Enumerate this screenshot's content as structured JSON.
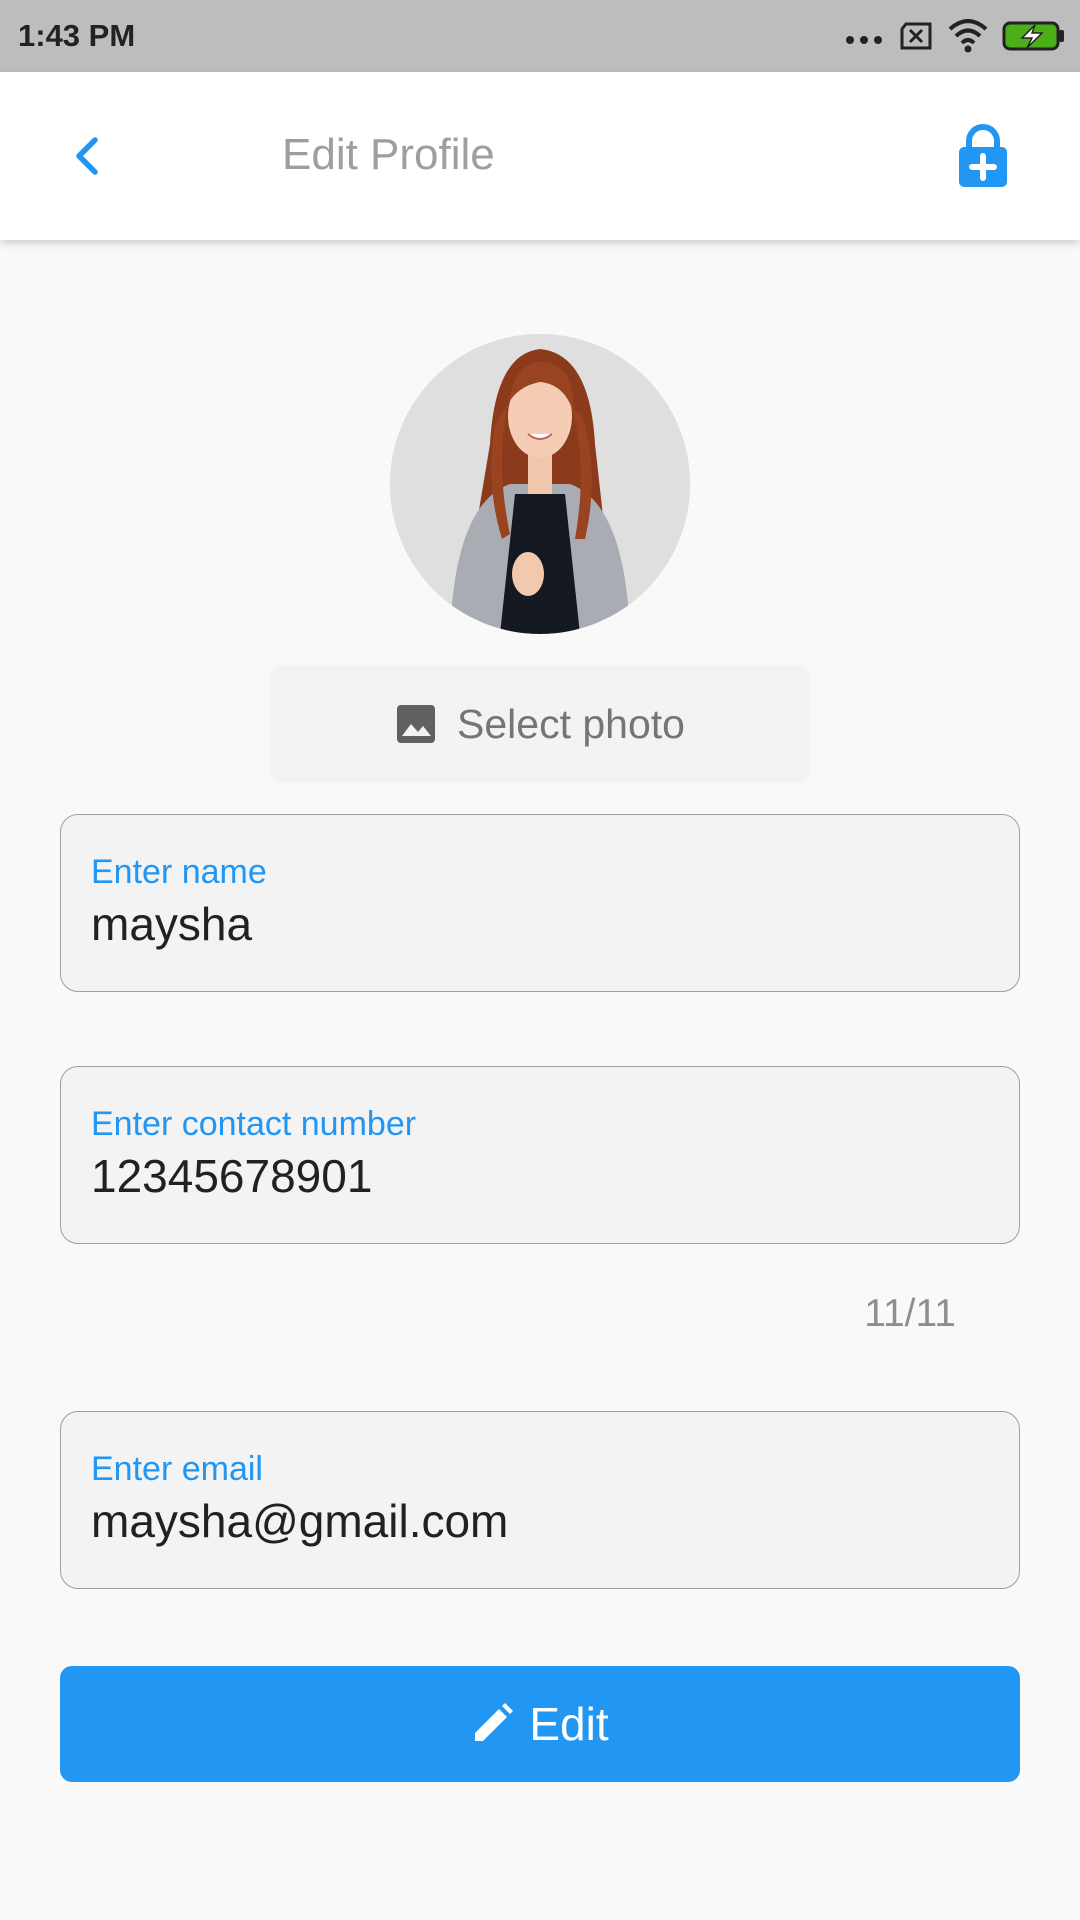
{
  "status_bar": {
    "time": "1:43 PM",
    "icons": [
      "more-dots-icon",
      "sim-blocked-icon",
      "wifi-icon",
      "battery-charging-icon"
    ],
    "battery_color": "#4caf1a"
  },
  "app_bar": {
    "title": "Edit Profile",
    "back_icon": "chevron-left-icon",
    "action_icon": "lock-plus-icon",
    "accent_color": "#2196f3"
  },
  "profile": {
    "avatar": "profile-photo",
    "select_photo_label": "Select photo",
    "select_photo_icon": "image-icon"
  },
  "form": {
    "name": {
      "label": "Enter name",
      "value": "maysha"
    },
    "contact": {
      "label": "Enter contact number",
      "value": "12345678901",
      "counter": "11/11"
    },
    "email": {
      "label": "Enter email",
      "value": "maysha@gmail.com"
    }
  },
  "edit_button": {
    "label": "Edit",
    "icon": "pencil-icon"
  }
}
